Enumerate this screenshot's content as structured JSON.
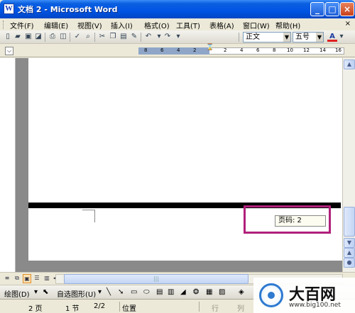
{
  "window": {
    "title": "文档 2 - Microsoft Word",
    "app_icon": "W",
    "minimize": "_",
    "maximize": "□",
    "close": "×"
  },
  "menu": {
    "items": [
      "文件(F)",
      "编辑(E)",
      "视图(V)",
      "插入(I)",
      "格式(O)",
      "工具(T)",
      "表格(A)",
      "窗口(W)",
      "帮助(H)"
    ],
    "close_label": "×"
  },
  "toolbar": {
    "style": "正文",
    "font_size": "五号",
    "font_color_icon": "A"
  },
  "ruler": {
    "ticks": [
      "8",
      "6",
      "4",
      "2",
      "2",
      "4",
      "6",
      "8",
      "10",
      "12",
      "14",
      "16"
    ]
  },
  "document": {
    "page_number_label": "页码: 2"
  },
  "drawing_toolbar": {
    "draw_label": "绘图(D)",
    "autoshapes_label": "自选图形(U)"
  },
  "status": {
    "page": "2 页",
    "section": "1 节",
    "page_of": "2/2",
    "position": "位置",
    "line": "行",
    "column": "列"
  },
  "watermark": {
    "title": "大百网",
    "url": "www.big100.net"
  },
  "colors": {
    "titlebar": "#0054e3",
    "highlight_box": "#b0207a",
    "watermark_blue": "#2e7ad0"
  }
}
